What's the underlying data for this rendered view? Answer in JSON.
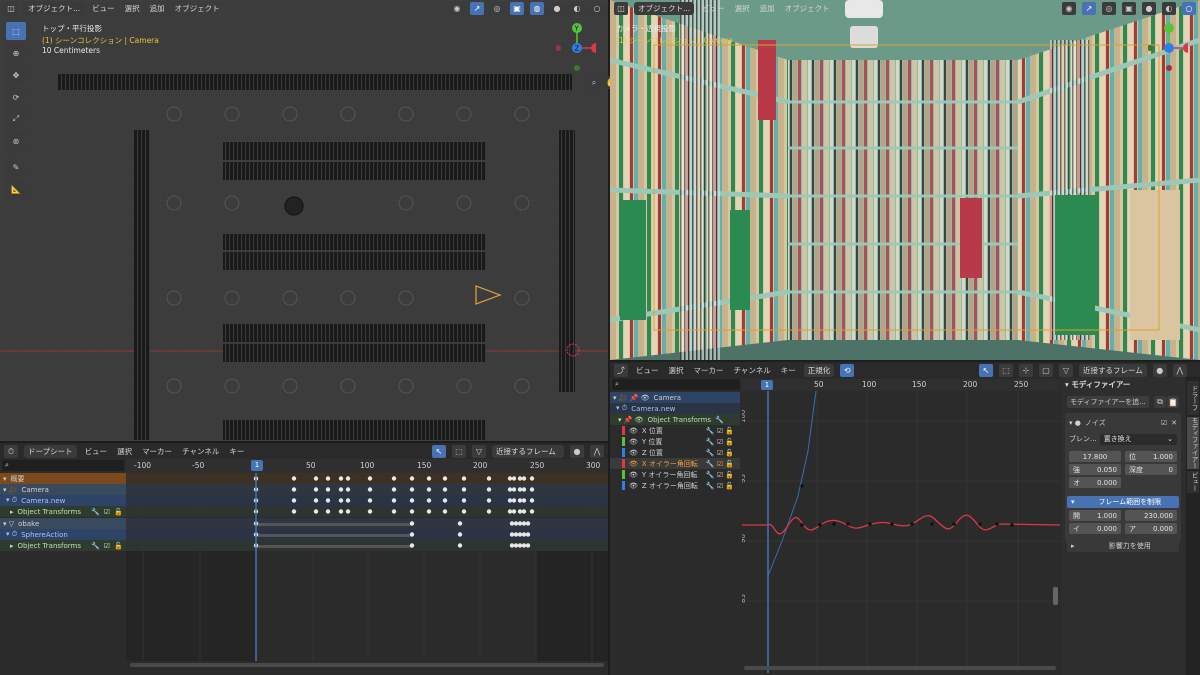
{
  "left_view": {
    "mode": "オブジェクト...",
    "menus": [
      "ビュー",
      "選択",
      "追加",
      "オブジェクト"
    ],
    "overlay_title": "トップ・平行投影",
    "overlay_collection": "(1) シーンコレクション | Camera",
    "overlay_scale": "10 Centimeters",
    "tools": [
      "select-box-icon",
      "cursor-icon",
      "move-icon",
      "rotate-icon",
      "scale-icon",
      "transform-icon",
      "annotate-icon",
      "measure-icon"
    ]
  },
  "right_view": {
    "mode": "オブジェクト...",
    "menus": [
      "ビュー",
      "選択",
      "追加",
      "オブジェクト"
    ],
    "overlay_title": "カメラ・透視投影",
    "overlay_collection": "(1) シーンコレクション | Camera"
  },
  "dopesheet": {
    "mode": "ドープシート",
    "menus": [
      "ビュー",
      "選択",
      "マーカー",
      "チャンネル",
      "キー"
    ],
    "snap": "近接するフレーム",
    "current_frame": "1",
    "ruler": [
      "-100",
      "-50",
      "1",
      "50",
      "100",
      "150",
      "200",
      "250",
      "300"
    ],
    "channels": [
      {
        "label": "概要",
        "kind": "summary"
      },
      {
        "label": "Camera",
        "kind": "object"
      },
      {
        "label": "Camera.new",
        "kind": "action"
      },
      {
        "label": "Object Transforms",
        "kind": "group"
      },
      {
        "label": "obake",
        "kind": "object"
      },
      {
        "label": "SphereAction",
        "kind": "action"
      },
      {
        "label": "Object Transforms",
        "kind": "group"
      }
    ]
  },
  "graph_editor": {
    "menus": [
      "ビュー",
      "選択",
      "マーカー",
      "チャンネル",
      "キー"
    ],
    "normalize": "正規化",
    "snap": "近接するフレーム",
    "current_frame": "1",
    "ruler": [
      "50",
      "100",
      "150",
      "200",
      "250"
    ],
    "y_ticks": [
      "100",
      "95",
      "90",
      "85"
    ],
    "channels": [
      {
        "label": "Camera",
        "color": ""
      },
      {
        "label": "Camera.new",
        "color": ""
      },
      {
        "label": "Object Transforms",
        "color": ""
      },
      {
        "label": "X 位置",
        "color": "#e0364a"
      },
      {
        "label": "Y 位置",
        "color": "#56c43b"
      },
      {
        "label": "Z 位置",
        "color": "#2f7fe6"
      },
      {
        "label": "X オイラー角回転",
        "color": "#e0364a"
      },
      {
        "label": "Y オイラー角回転",
        "color": "#56c43b"
      },
      {
        "label": "Z オイラー角回転",
        "color": "#2f7fe6"
      }
    ]
  },
  "modifiers_panel": {
    "title": "モディファイアー",
    "add_label": "モディファイアーを追...",
    "noise_label": "ノイズ",
    "blend_label": "ブレン...",
    "blend_value": "置き換え",
    "scale_value": "17.800",
    "phase_label": "位",
    "phase_value": "1.000",
    "strength_label": "強",
    "strength_value": "0.050",
    "depth_label": "深度",
    "depth_value": "0",
    "offset_label": "オ",
    "offset_value": "0.000",
    "restrict_label": "フレーム範囲を制限",
    "start_label": "開",
    "start_value": "1.000",
    "end_value": "230.000",
    "in_label": "イ",
    "in_value": "0.000",
    "out_label": "ア",
    "out_value": "0.000",
    "influence_label": "影響力を使用",
    "side_tabs": [
      "ドラーフ",
      "モディファイアー",
      "ビュー"
    ]
  },
  "colors": {
    "accent": "#4772b3",
    "overlay_yellow": "#e8c53c",
    "curve_red": "#e0364a"
  }
}
